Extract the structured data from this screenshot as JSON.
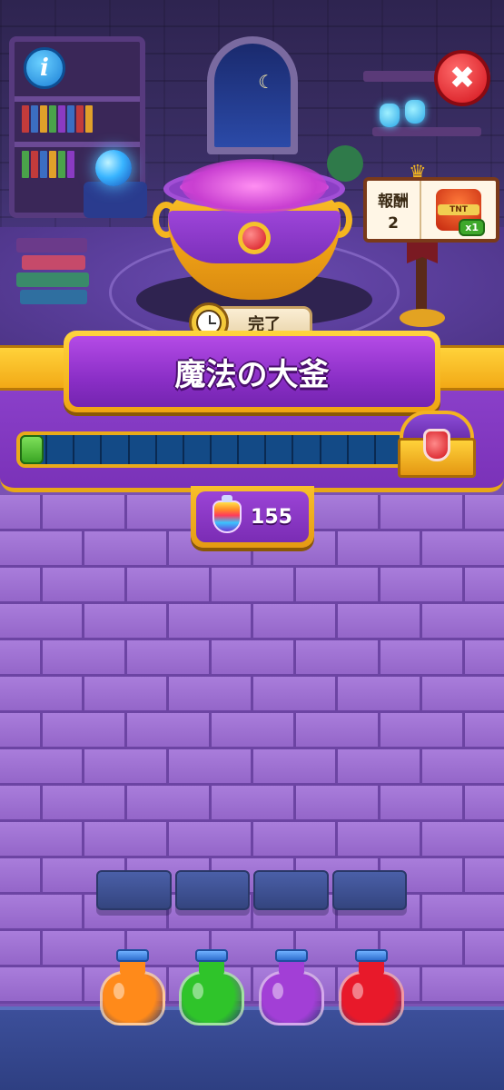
{
  "header": {
    "info_label": "i",
    "close_label": "✖"
  },
  "cauldron": {
    "status_label": "完了"
  },
  "reward": {
    "label": "報酬",
    "count": "2",
    "item_name": "TNT",
    "item_qty": "x1",
    "icon": "tnt-icon"
  },
  "title": {
    "text": "魔法の大釜"
  },
  "progress": {
    "segments": 14,
    "filled_fraction": 0.06,
    "reward_icon": "treasure-chest-icon"
  },
  "potion_counter": {
    "value": "155",
    "icon": "rainbow-potion-icon"
  },
  "shelf": {
    "slots": 4
  },
  "potions": [
    {
      "name": "orange-potion",
      "color": "#ff8a1a"
    },
    {
      "name": "green-potion",
      "color": "#2fc42a"
    },
    {
      "name": "purple-potion",
      "color": "#a23fd6"
    },
    {
      "name": "red-potion",
      "color": "#e8192a"
    }
  ],
  "colors": {
    "banner_gold": "#f2a916",
    "banner_purple": "#8b2fc7",
    "wall_purple": "#9a6ccf",
    "progress_fill": "#3aa524"
  }
}
